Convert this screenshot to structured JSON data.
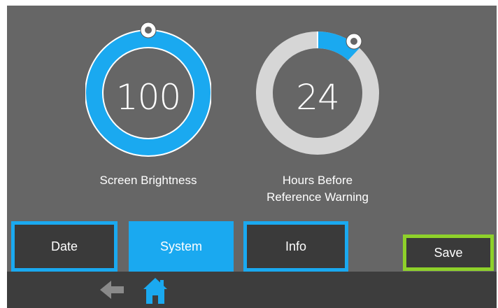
{
  "colors": {
    "background": "#666666",
    "accent": "#1aa9f0",
    "track": "#d6d6d6",
    "save_outline": "#8ed12a",
    "button_dark": "#3a3a3a",
    "bottom_bar": "#3d3d3d",
    "back_arrow": "#8a8a8a"
  },
  "dials": [
    {
      "id": "screen-brightness",
      "value": "100",
      "label": "Screen Brightness",
      "fill_fraction": 1.0
    },
    {
      "id": "hours-before-reference-warning",
      "value": "24",
      "label": "Hours Before Reference Warning",
      "fill_fraction": 0.12
    }
  ],
  "tabs": [
    {
      "label": "Date",
      "state": "outlined"
    },
    {
      "label": "System",
      "state": "active"
    },
    {
      "label": "Info",
      "state": "outlined"
    }
  ],
  "save_button": {
    "label": "Save"
  },
  "bottom_nav": {
    "back_icon": "arrow-left-icon",
    "home_icon": "home-icon"
  }
}
